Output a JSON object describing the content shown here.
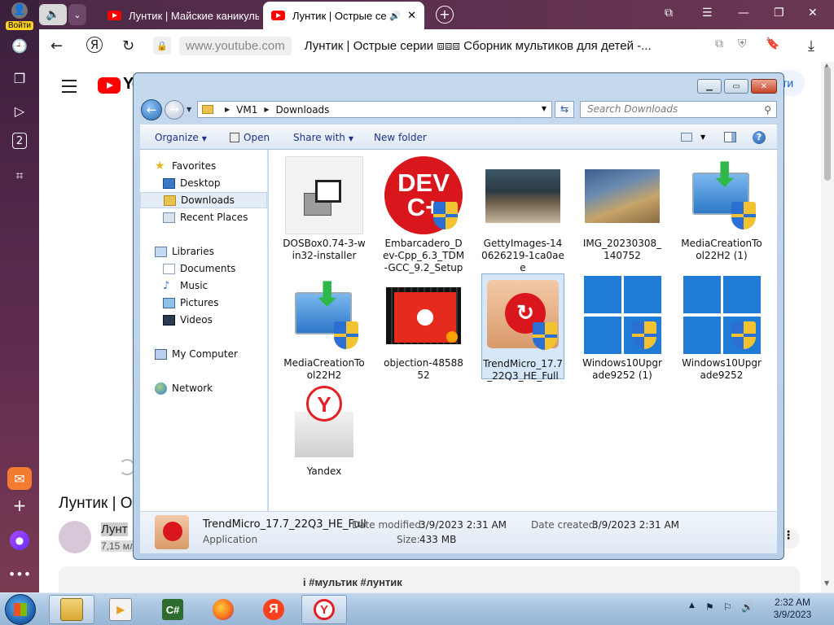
{
  "browser": {
    "login_label": "Войти",
    "tabs": [
      {
        "title": "Лунтик | Майские каникулы",
        "active": false
      },
      {
        "title": "Лунтик | Острые сер",
        "active": true
      }
    ],
    "url_domain": "www.youtube.com",
    "page_title": "Лунтик | Острые серии ⧈⧈⧈ Сборник мультиков для детей -..."
  },
  "youtube": {
    "logo_text": "Yo",
    "signin_fragment": "ти",
    "video_title_fragment": "Лунтик | О",
    "channel_name_fragment": "Лунт",
    "channel_subs_fragment": "7,15 мл",
    "description_tags": "i #мультик #лунтик",
    "more_label": "⋮"
  },
  "explorer": {
    "breadcrumb": [
      "VM1",
      "Downloads"
    ],
    "search_placeholder": "Search Downloads",
    "toolbar": {
      "organize": "Organize",
      "open": "Open",
      "share_with": "Share with",
      "new_folder": "New folder"
    },
    "nav": {
      "favorites": "Favorites",
      "desktop": "Desktop",
      "downloads": "Downloads",
      "recent_places": "Recent Places",
      "libraries": "Libraries",
      "documents": "Documents",
      "music": "Music",
      "pictures": "Pictures",
      "videos": "Videos",
      "my_computer": "My Computer",
      "network": "Network"
    },
    "files": [
      {
        "name": "DOSBox0.74-3-win32-installer",
        "icon": "installer-icon"
      },
      {
        "name": "Embarcadero_Dev-Cpp_6.3_TDM-GCC_9.2_Setup",
        "icon": "devcpp-icon",
        "icon_text": [
          "DEV",
          "C+"
        ]
      },
      {
        "name": "GettyImages-140626219-1ca0aee",
        "icon": "photo-thumbnail"
      },
      {
        "name": "IMG_20230308_140752",
        "icon": "photo-thumbnail"
      },
      {
        "name": "MediaCreationTool22H2 (1)",
        "icon": "media-creation-icon"
      },
      {
        "name": "MediaCreationTool22H2",
        "icon": "media-creation-icon"
      },
      {
        "name": "objection-4858852",
        "icon": "video-thumbnail"
      },
      {
        "name": "TrendMicro_17.7_22Q3_HE_Full",
        "icon": "trendmicro-icon",
        "selected": true
      },
      {
        "name": "Windows10Upgrade9252 (1)",
        "icon": "windows-logo-icon"
      },
      {
        "name": "Windows10Upgrade9252",
        "icon": "windows-logo-icon"
      },
      {
        "name": "Yandex",
        "icon": "yandex-installer-icon",
        "icon_text": "Y"
      }
    ],
    "details": {
      "name": "TrendMicro_17.7_22Q3_HE_Full",
      "type": "Application",
      "date_modified_label": "Date modified:",
      "date_modified": "3/9/2023 2:31 AM",
      "size_label": "Size:",
      "size": "433 MB",
      "date_created_label": "Date created:",
      "date_created": "3/9/2023 2:31 AM"
    }
  },
  "taskbar": {
    "time": "2:32 AM",
    "date": "3/9/2023",
    "apps": [
      {
        "name": "windows-explorer",
        "label": "",
        "active": true
      },
      {
        "name": "media-player",
        "label": "",
        "active": false
      },
      {
        "name": "csharp-ide",
        "label": "C#",
        "active": false
      },
      {
        "name": "firefox",
        "label": "",
        "active": false
      },
      {
        "name": "yandex",
        "label": "Я",
        "active": false
      },
      {
        "name": "yandex-browser",
        "label": "Y",
        "active": true
      }
    ]
  },
  "colors": {
    "youtube_red": "#ff0000",
    "explorer_link": "#1e3287",
    "selection": "#d6e7fa"
  }
}
